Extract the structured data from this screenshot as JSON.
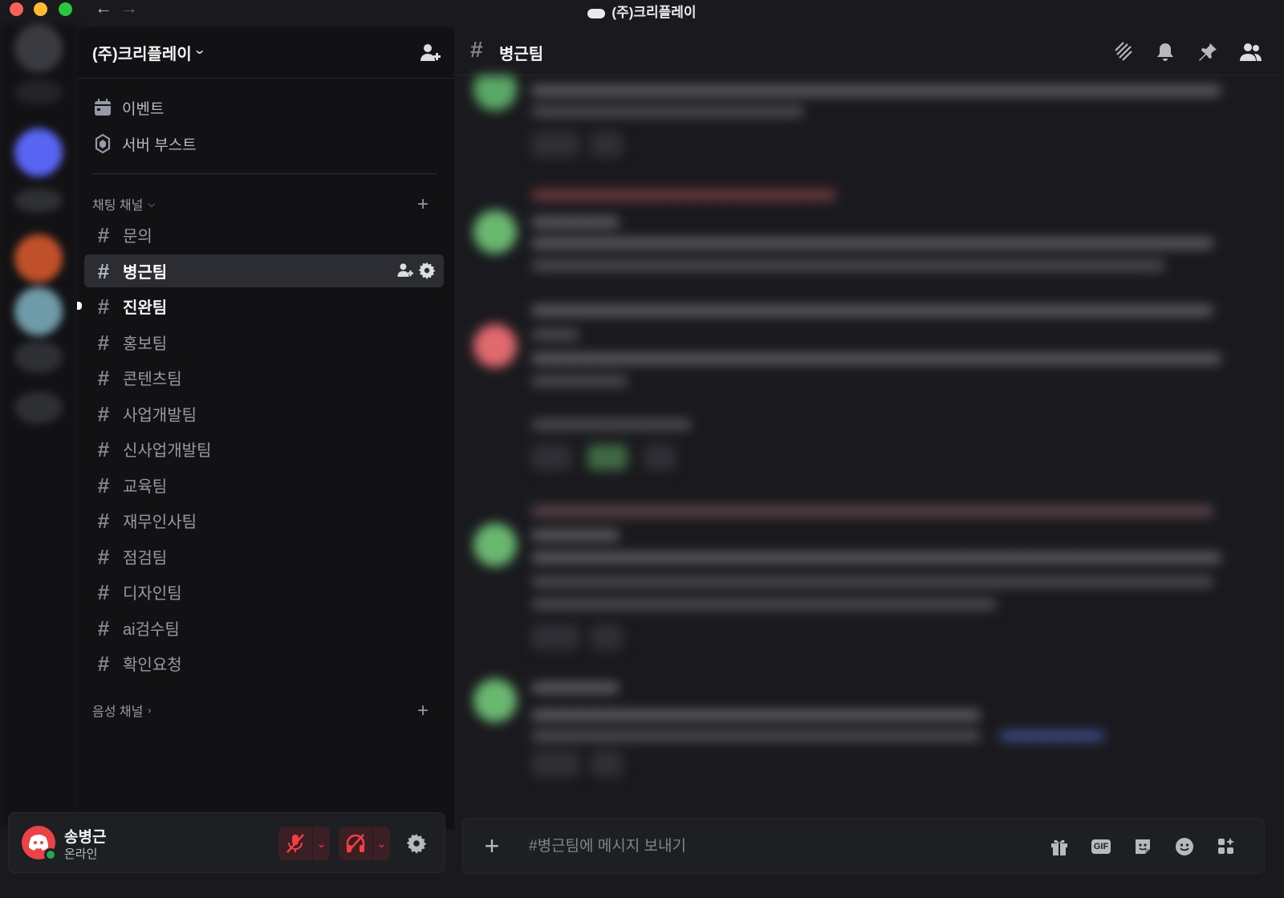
{
  "window": {
    "title": "(주)크리플레이"
  },
  "server": {
    "name": "(주)크리플레이"
  },
  "sidebar": {
    "menu": [
      {
        "label": "이벤트",
        "icon": "calendar-icon"
      },
      {
        "label": "서버 부스트",
        "icon": "boost-icon"
      }
    ],
    "text_category": "채팅 채널",
    "voice_category": "음성 채널",
    "channels": [
      {
        "name": "문의",
        "state": "normal"
      },
      {
        "name": "병근팀",
        "state": "active"
      },
      {
        "name": "진완팀",
        "state": "unread"
      },
      {
        "name": "홍보팀",
        "state": "normal"
      },
      {
        "name": "콘텐츠팀",
        "state": "normal"
      },
      {
        "name": "사업개발팀",
        "state": "normal"
      },
      {
        "name": "신사업개발팀",
        "state": "normal"
      },
      {
        "name": "교육팀",
        "state": "normal"
      },
      {
        "name": "재무인사팀",
        "state": "normal"
      },
      {
        "name": "점검팀",
        "state": "normal"
      },
      {
        "name": "디자인팀",
        "state": "normal"
      },
      {
        "name": "ai검수팀",
        "state": "normal"
      },
      {
        "name": "확인요청",
        "state": "normal"
      }
    ]
  },
  "user": {
    "name": "송병근",
    "status": "온라인",
    "avatar_color": "#ed4245",
    "status_color": "#23a55a"
  },
  "chat": {
    "channel": "병근팀",
    "composer_placeholder": "#병근팀에 메시지 보내기"
  },
  "colors": {
    "accent": "#5865f2",
    "danger": "#f23f43",
    "active_bg": "#2c2d32"
  }
}
